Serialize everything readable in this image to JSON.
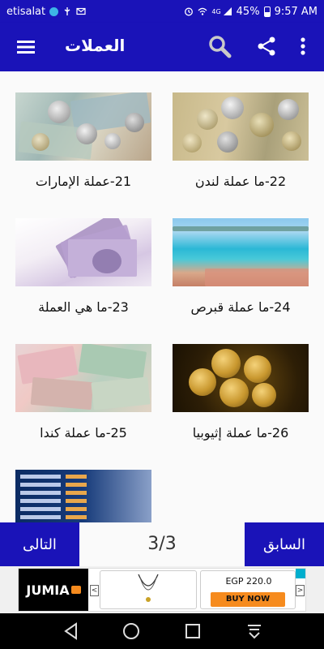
{
  "status_bar": {
    "carrier": "etisalat",
    "battery": "45%",
    "time": "9:57 AM",
    "network": "4G"
  },
  "app_bar": {
    "title": "العملات",
    "icons": [
      "menu-icon",
      "search-icon",
      "share-icon",
      "more-vert-icon"
    ]
  },
  "items": [
    {
      "caption": "21-عملة الإمارات",
      "thumb": "coins-on-banknotes"
    },
    {
      "caption": "22-ما عملة لندن",
      "thumb": "coins-pile"
    },
    {
      "caption": "23-ما هي العملة",
      "thumb": "pound-notes-fan"
    },
    {
      "caption": "24-ما عملة قبرص",
      "thumb": "beach"
    },
    {
      "caption": "25-ما عملة كندا",
      "thumb": "mixed-banknotes"
    },
    {
      "caption": "26-ما عملة إثيوبيا",
      "thumb": "gold-coins"
    },
    {
      "caption": "",
      "thumb": "currency-exchange-board"
    }
  ],
  "pager": {
    "next_label": "التالى",
    "prev_label": "السابق",
    "indicator": "3/3"
  },
  "ad": {
    "brand": "JUMIA",
    "price": "EGP 220.0",
    "cta": "BUY NOW",
    "prev_arrow": "<",
    "next_arrow": ">"
  },
  "colors": {
    "primary": "#1a13b8",
    "background": "#fafafa",
    "ad_orange": "#f68b1e"
  },
  "nav_bar": [
    "back-icon",
    "home-icon",
    "recents-icon",
    "keyboard-hide-icon"
  ]
}
